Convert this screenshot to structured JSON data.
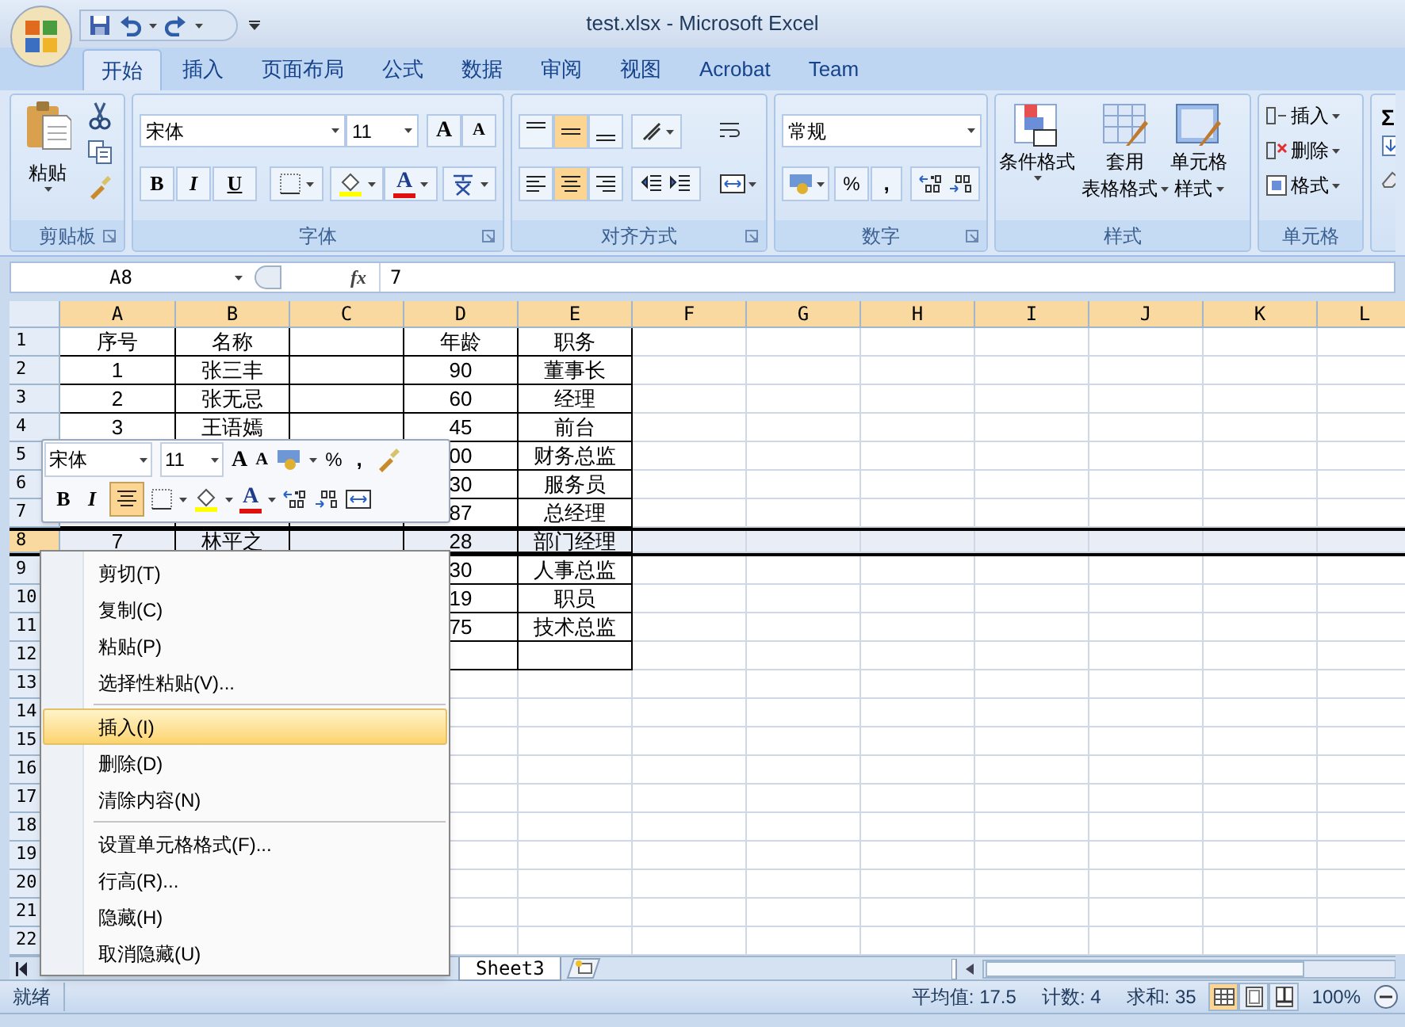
{
  "window": {
    "title": "test.xlsx - Microsoft Excel"
  },
  "tabs": [
    {
      "label": "开始",
      "selected": true
    },
    {
      "label": "插入",
      "selected": false
    },
    {
      "label": "页面布局",
      "selected": false
    },
    {
      "label": "公式",
      "selected": false
    },
    {
      "label": "数据",
      "selected": false
    },
    {
      "label": "审阅",
      "selected": false
    },
    {
      "label": "视图",
      "selected": false
    },
    {
      "label": "Acrobat",
      "selected": false
    },
    {
      "label": "Team",
      "selected": false
    }
  ],
  "ribbon": {
    "clipboard": {
      "paste": "粘贴",
      "label": "剪贴板"
    },
    "font": {
      "family": "宋体",
      "size": "11",
      "grow": "A",
      "shrink": "A",
      "bold": "B",
      "italic": "I",
      "underline": "U",
      "color_glyph": "A",
      "label": "字体"
    },
    "alignment": {
      "buttons": [
        {
          "selected": false
        },
        {
          "selected": true
        },
        {
          "selected": false
        },
        {
          "selected": false
        },
        {
          "selected": true
        },
        {
          "selected": false
        }
      ],
      "label": "对齐方式"
    },
    "number": {
      "format": "常规",
      "percent": "%",
      "comma": ",",
      "label": "数字"
    },
    "styles": {
      "buttons": [
        {
          "lines": [
            "条件格式"
          ]
        },
        {
          "lines": [
            "套用",
            "表格格式"
          ]
        },
        {
          "lines": [
            "单元格",
            "样式"
          ]
        }
      ],
      "label": "样式"
    },
    "cells": {
      "buttons": [
        "插入",
        "删除",
        "格式"
      ],
      "label": "单元格"
    },
    "editing": {
      "sum": "Σ"
    }
  },
  "formula_bar": {
    "name_box": "A8",
    "fx": "fx",
    "value": "7"
  },
  "grid": {
    "columns": [
      "A",
      "B",
      "C",
      "D",
      "E",
      "F",
      "G",
      "H",
      "I",
      "J",
      "K",
      "L"
    ],
    "rows": [
      {
        "header": "1",
        "selected": false,
        "bordered": true,
        "cells": {
          "A": "序号",
          "B": "名称",
          "D": "年龄",
          "E": "职务"
        }
      },
      {
        "header": "2",
        "selected": false,
        "bordered": true,
        "cells": {
          "A": "1",
          "B": "张三丰",
          "D": "90",
          "E": "董事长"
        }
      },
      {
        "header": "3",
        "selected": false,
        "bordered": true,
        "cells": {
          "A": "2",
          "B": "张无忌",
          "D": "60",
          "E": "经理"
        }
      },
      {
        "header": "4",
        "selected": false,
        "bordered": true,
        "cells": {
          "A": "3",
          "B": "王语嫣",
          "D": "45",
          "E": "前台"
        }
      },
      {
        "header": "5",
        "selected": false,
        "bordered": true,
        "cells": {
          "D": "00",
          "E": "财务总监"
        }
      },
      {
        "header": "6",
        "selected": false,
        "bordered": true,
        "cells": {
          "D": "30",
          "E": "服务员"
        }
      },
      {
        "header": "7",
        "selected": false,
        "bordered": true,
        "cells": {
          "D": "87",
          "E": "总经理"
        }
      },
      {
        "header": "8",
        "selected": true,
        "bordered": true,
        "cells": {
          "A": "7",
          "B": "林平之",
          "D": "28",
          "E": "部门经理"
        }
      },
      {
        "header": "9",
        "selected": false,
        "bordered": true,
        "cells": {
          "D": "30",
          "E": "人事总监"
        }
      },
      {
        "header": "10",
        "selected": false,
        "bordered": true,
        "cells": {
          "D": "19",
          "E": "职员"
        }
      },
      {
        "header": "11",
        "selected": false,
        "bordered": true,
        "cells": {
          "D": "75",
          "E": "技术总监"
        }
      },
      {
        "header": "12",
        "selected": false,
        "bordered": true,
        "cells": {}
      },
      {
        "header": "13",
        "selected": false,
        "bordered": false,
        "cells": {}
      },
      {
        "header": "14",
        "selected": false,
        "bordered": false,
        "cells": {}
      },
      {
        "header": "15",
        "selected": false,
        "bordered": false,
        "cells": {}
      },
      {
        "header": "16",
        "selected": false,
        "bordered": false,
        "cells": {}
      },
      {
        "header": "17",
        "selected": false,
        "bordered": false,
        "cells": {}
      },
      {
        "header": "18",
        "selected": false,
        "bordered": false,
        "cells": {}
      },
      {
        "header": "19",
        "selected": false,
        "bordered": false,
        "cells": {}
      },
      {
        "header": "20",
        "selected": false,
        "bordered": false,
        "cells": {}
      },
      {
        "header": "21",
        "selected": false,
        "bordered": false,
        "cells": {}
      },
      {
        "header": "22",
        "selected": false,
        "bordered": false,
        "cells": {}
      }
    ]
  },
  "mini_toolbar": {
    "family": "宋体",
    "size": "11",
    "grow": "A",
    "shrink": "A",
    "percent": "%",
    "comma": ",",
    "bold": "B",
    "italic": "I",
    "center_selected": true,
    "color_glyph": "A"
  },
  "context_menu": {
    "items": [
      {
        "kind": "item",
        "label": "剪切(T)",
        "selected": false
      },
      {
        "kind": "item",
        "label": "复制(C)",
        "selected": false
      },
      {
        "kind": "item",
        "label": "粘贴(P)",
        "selected": false
      },
      {
        "kind": "item",
        "label": "选择性粘贴(V)...",
        "selected": false
      },
      {
        "kind": "separator"
      },
      {
        "kind": "item",
        "label": "插入(I)",
        "selected": true
      },
      {
        "kind": "item",
        "label": "删除(D)",
        "selected": false
      },
      {
        "kind": "item",
        "label": "清除内容(N)",
        "selected": false
      },
      {
        "kind": "separator"
      },
      {
        "kind": "item",
        "label": "设置单元格格式(F)...",
        "selected": false
      },
      {
        "kind": "item",
        "label": "行高(R)...",
        "selected": false
      },
      {
        "kind": "item",
        "label": "隐藏(H)",
        "selected": false
      },
      {
        "kind": "item",
        "label": "取消隐藏(U)",
        "selected": false
      }
    ]
  },
  "sheet_tabs": [
    {
      "label": "Sheet3"
    }
  ],
  "status_bar": {
    "mode": "就绪",
    "average": "平均值: 17.5",
    "count": "计数: 4",
    "sum": "求和: 35",
    "views": [
      {
        "selected": true
      },
      {
        "selected": false
      },
      {
        "selected": false
      }
    ],
    "zoom": "100%"
  }
}
